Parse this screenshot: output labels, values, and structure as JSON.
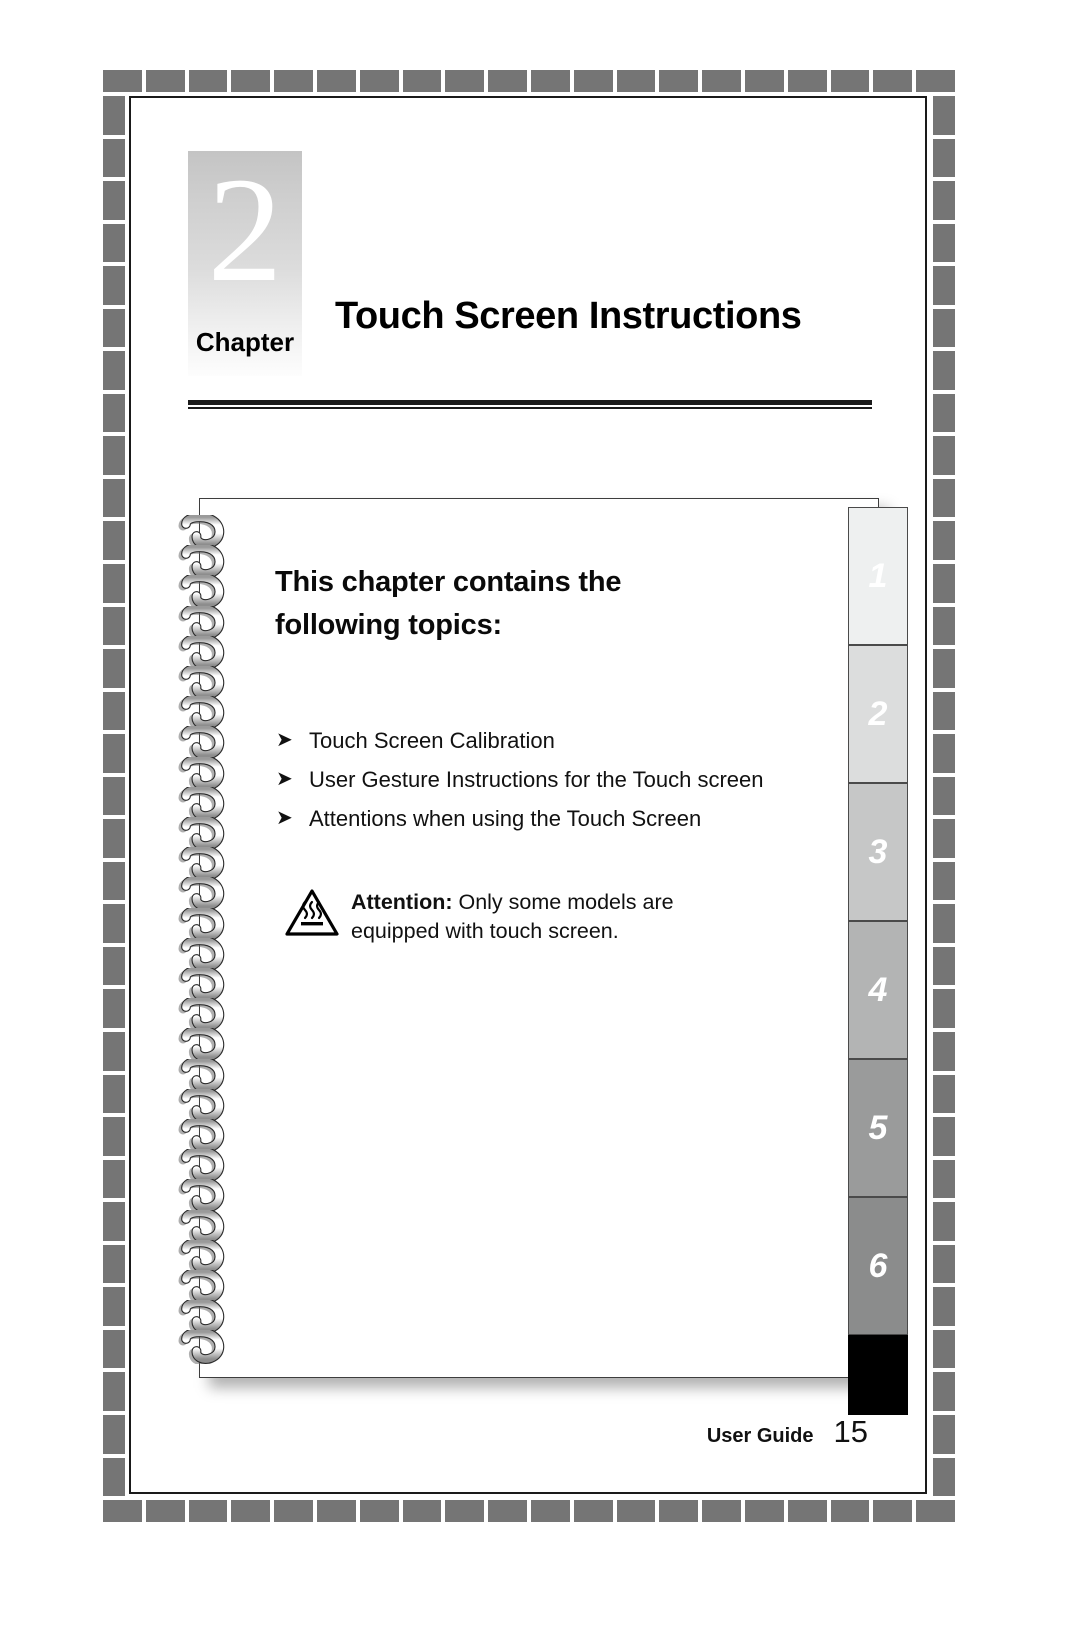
{
  "chapter": {
    "number": "2",
    "label": "Chapter",
    "title": "Touch Screen Instructions"
  },
  "notebook": {
    "heading": "This chapter contains the following topics:",
    "bullet_glyph": "➤",
    "topics": [
      "Touch Screen Calibration",
      "User Gesture Instructions for the Touch screen",
      "Attentions when using the Touch Screen"
    ],
    "attention": {
      "icon": "hot-surface-warning-icon",
      "label": "Attention:",
      "text": " Only some models are equipped with touch screen."
    }
  },
  "tabs": [
    {
      "number": "1",
      "color": "#eef0f0"
    },
    {
      "number": "2",
      "color": "#dcdddd"
    },
    {
      "number": "3",
      "color": "#c6c7c7"
    },
    {
      "number": "4",
      "color": "#b3b4b4"
    },
    {
      "number": "5",
      "color": "#9a9b9b"
    },
    {
      "number": "6",
      "color": "#8b8c8c"
    },
    {
      "number": "",
      "color": "#000000"
    }
  ],
  "footer": {
    "label": "User Guide",
    "page": "15"
  },
  "colors": {
    "frame_dash": "#757575",
    "page_border": "#1a1a1a",
    "rule": "#1b1b1b",
    "badge_top": "#c4c4c4",
    "badge_bottom": "#fdfdfd"
  }
}
